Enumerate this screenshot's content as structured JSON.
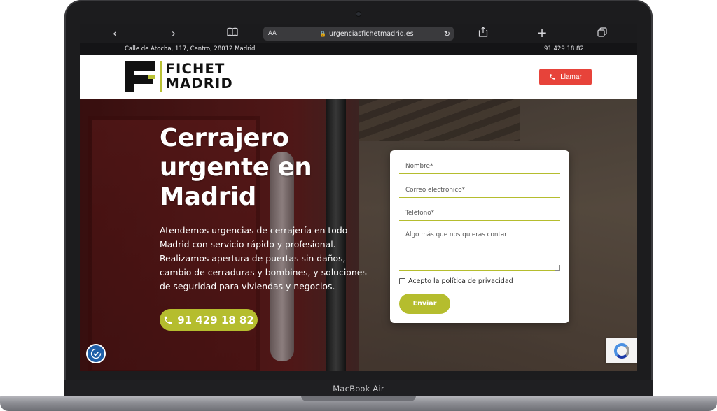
{
  "device": {
    "model_label": "MacBook Air"
  },
  "browser": {
    "back_icon": "‹",
    "forward_icon": "›",
    "bookmarks_icon": "book-icon",
    "text_size_label": "AA",
    "url": "urgenciasfichetmadrid.es",
    "share_icon": "share-icon",
    "new_tab_icon": "+",
    "tabs_icon": "tabs-icon"
  },
  "info_strip": {
    "address": "Calle de Atocha, 117, Centro, 28012 Madrid",
    "phone": "91 429 18 82"
  },
  "header": {
    "logo_line1": "FICHET",
    "logo_line2": "MADRID",
    "call_label": "Llamar",
    "accent_color": "#b5bd2e",
    "call_color": "#e7433a"
  },
  "hero": {
    "title": "Cerrajero urgente en Madrid",
    "description": "Atendemos urgencias de cerrajería en todo Madrid con servicio rápido y profesional. Realizamos apertura de puertas sin daños, cambio de cerraduras y bombines, y soluciones de seguridad para viviendas y negocios.",
    "phone_button": "91 429 18 82"
  },
  "form": {
    "name_placeholder": "Nombre*",
    "email_placeholder": "Correo electrónico*",
    "phone_placeholder": "Teléfono*",
    "message_placeholder": "Algo más que nos quieras contar",
    "privacy_label": "Acepto la política de privacidad",
    "submit_label": "Enviar"
  }
}
